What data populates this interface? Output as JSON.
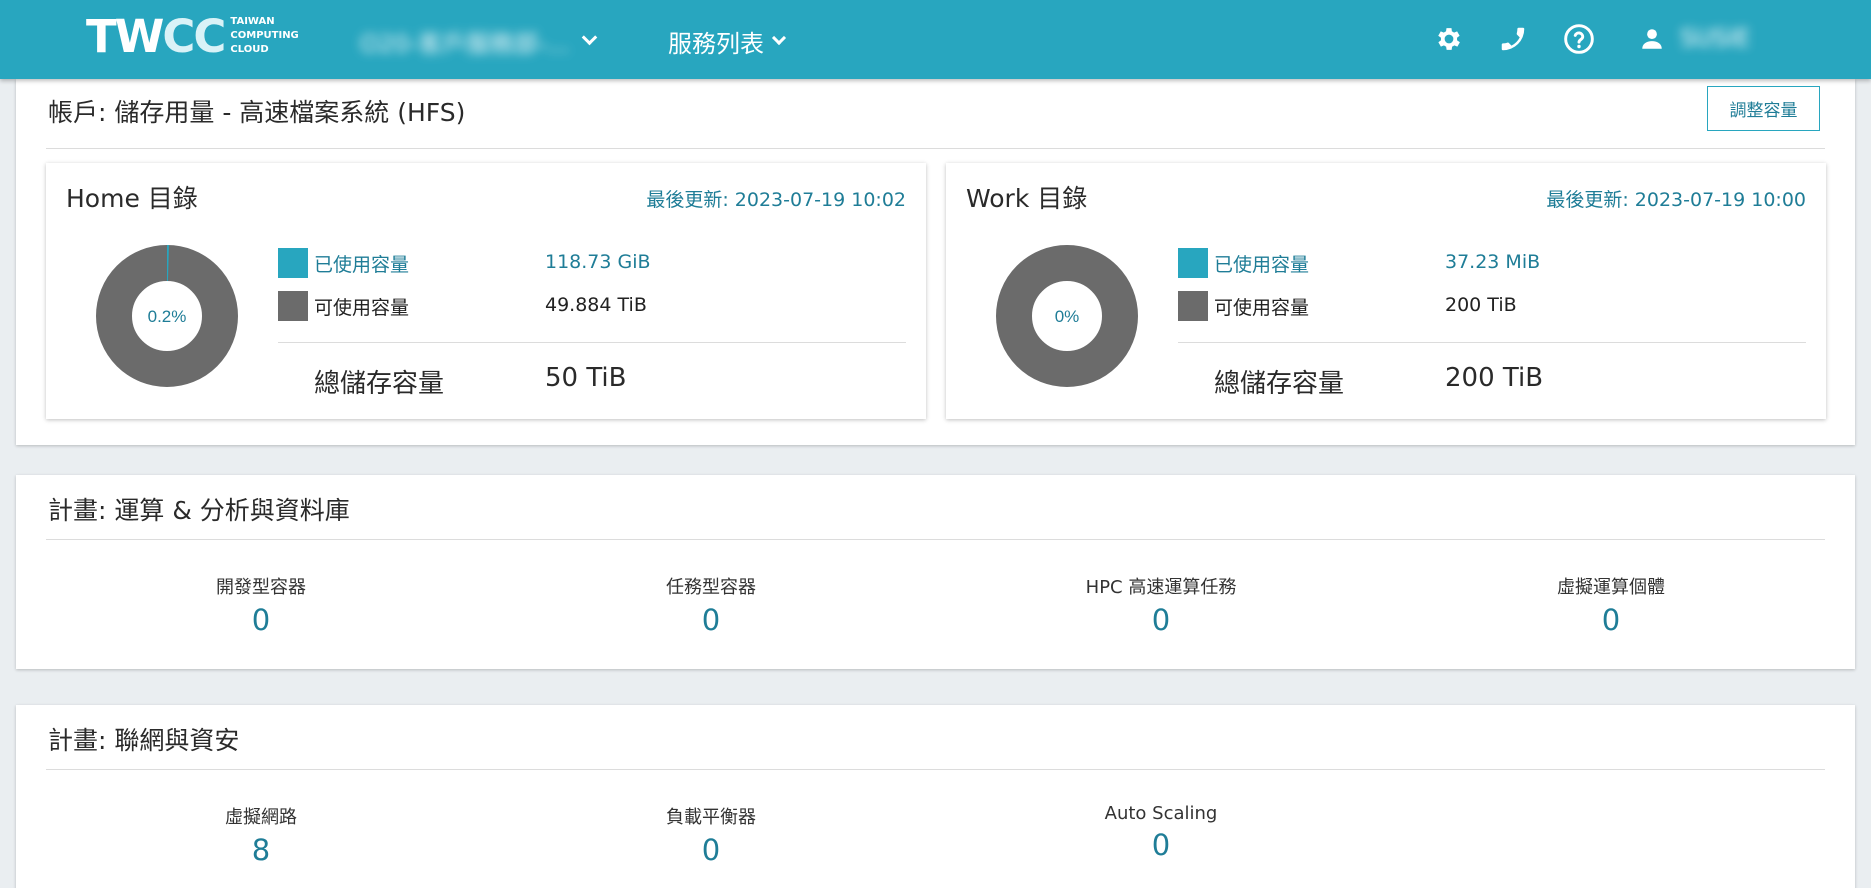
{
  "navbar": {
    "logo_text_main": "TW",
    "logo_text_cc": "CC",
    "logo_text_small": "TAIWAN\nCOMPUTING\nCLOUD",
    "project_name": "O20-客戶服務部-...",
    "services_label": "服務列表",
    "user_name": "SUSIE",
    "icons": [
      "gear-icon",
      "phone-icon",
      "help-icon",
      "user-icon"
    ]
  },
  "storage": {
    "title": "帳戶: 儲存用量 - 高速檔案系統 (HFS)",
    "adjust_button": "調整容量",
    "home": {
      "title": "Home 目錄",
      "updated": "最後更新: 2023-07-19 10:02",
      "percent_label": "0.2%",
      "used_fraction": 0.002,
      "used_label": "已使用容量",
      "used_value": "118.73 GiB",
      "available_label": "可使用容量",
      "available_value": "49.884 TiB",
      "total_label": "總儲存容量",
      "total_value": "50 TiB"
    },
    "work": {
      "title": "Work 目錄",
      "updated": "最後更新: 2023-07-19 10:00",
      "percent_label": "0%",
      "used_fraction": 0.0,
      "used_label": "已使用容量",
      "used_value": "37.23 MiB",
      "available_label": "可使用容量",
      "available_value": "200 TiB",
      "total_label": "總儲存容量",
      "total_value": "200 TiB"
    },
    "colors": {
      "used": "#28a6bf",
      "available": "#6b6b6b"
    }
  },
  "compute": {
    "title": "計畫: 運算 & 分析與資料庫",
    "stats": [
      {
        "label": "開發型容器",
        "value": "0"
      },
      {
        "label": "任務型容器",
        "value": "0"
      },
      {
        "label": "HPC 高速運算任務",
        "value": "0"
      },
      {
        "label": "虛擬運算個體",
        "value": "0"
      }
    ]
  },
  "network": {
    "title": "計畫: 聯網與資安",
    "stats": [
      {
        "label": "虛擬網路",
        "value": "8"
      },
      {
        "label": "負載平衡器",
        "value": "0"
      },
      {
        "label": "Auto Scaling",
        "value": "0"
      }
    ]
  }
}
